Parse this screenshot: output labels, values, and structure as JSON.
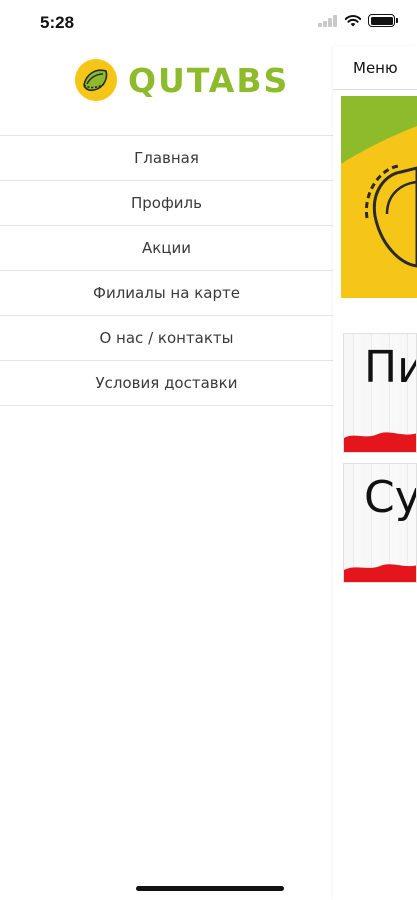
{
  "status_bar": {
    "time": "5:28"
  },
  "brand": {
    "name": "QUTABS",
    "logo_color": "#8dbb2c",
    "mark_color": "#f5c518"
  },
  "drawer": {
    "items": [
      {
        "label": "Главная"
      },
      {
        "label": "Профиль"
      },
      {
        "label": "Акции"
      },
      {
        "label": "Филиалы на карте"
      },
      {
        "label": "О нас / контакты"
      },
      {
        "label": "Условия доставки"
      }
    ]
  },
  "main": {
    "header_title": "Меню",
    "categories": [
      {
        "label": "Пи"
      },
      {
        "label": "Су"
      }
    ]
  },
  "colors": {
    "accent_green": "#8dbb2c",
    "accent_yellow": "#f5c518",
    "accent_red": "#e4161b"
  }
}
